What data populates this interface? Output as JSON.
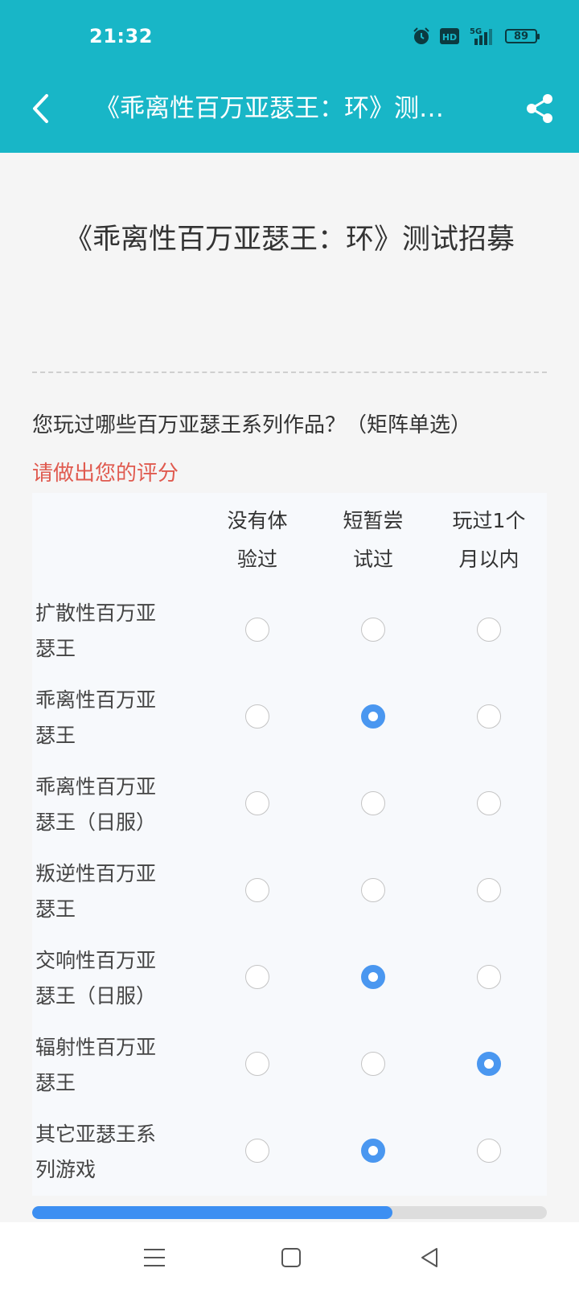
{
  "status_bar": {
    "time": "21:32",
    "battery": "89",
    "network": "5G",
    "hd_label": "HD"
  },
  "nav": {
    "title": "《乖离性百万亚瑟王：环》测…"
  },
  "page": {
    "title": "《乖离性百万亚瑟王：环》测试招募"
  },
  "question": {
    "text": "您玩过哪些百万亚瑟王系列作品？（矩阵单选）",
    "hint": "请做出您的评分",
    "columns": [
      "没有体验过",
      "短暂尝试过",
      "玩过1个月以内"
    ],
    "rows": [
      {
        "label": "扩散性百万亚瑟王",
        "selected": -1
      },
      {
        "label": "乖离性百万亚瑟王",
        "selected": 1
      },
      {
        "label": "乖离性百万亚瑟王（日服）",
        "selected": -1
      },
      {
        "label": "叛逆性百万亚瑟王",
        "selected": -1
      },
      {
        "label": "交响性百万亚瑟王（日服）",
        "selected": 1
      },
      {
        "label": "辐射性百万亚瑟王",
        "selected": 2
      },
      {
        "label": "其它亚瑟王系列游戏",
        "selected": 1
      }
    ]
  },
  "progress": {
    "fraction": 0.7
  },
  "colors": {
    "header": "#18b6c7",
    "accent": "#4a97f0",
    "hint": "#e05a4f"
  }
}
